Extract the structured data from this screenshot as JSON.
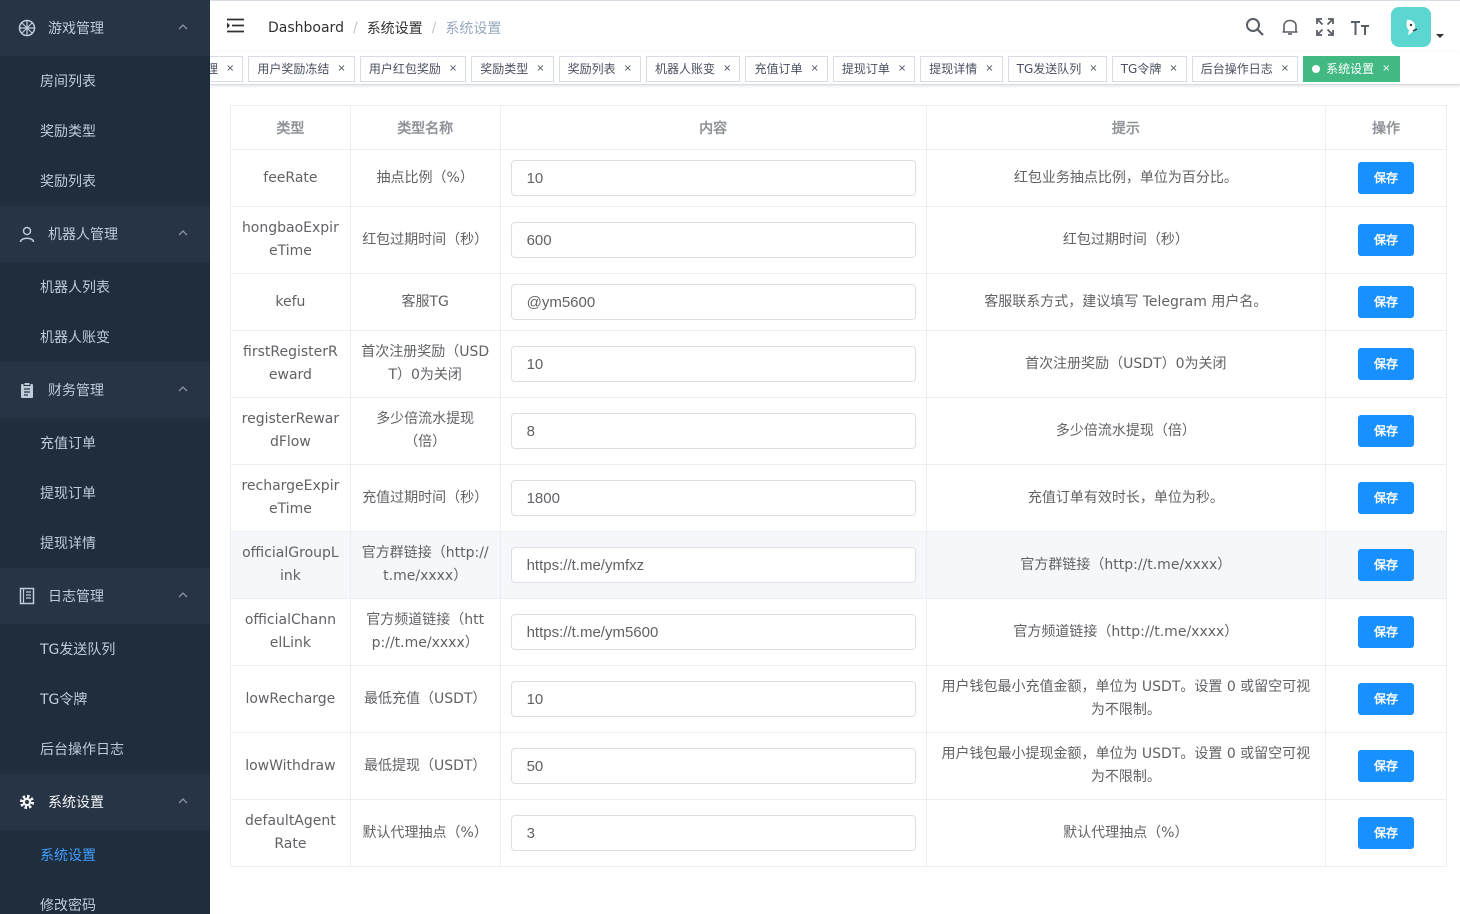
{
  "sidebar": {
    "groups": [
      {
        "label": "游戏管理",
        "icon": "game-icon",
        "items": [
          "房间列表",
          "奖励类型",
          "奖励列表"
        ]
      },
      {
        "label": "机器人管理",
        "icon": "user-icon",
        "items": [
          "机器人列表",
          "机器人账变"
        ]
      },
      {
        "label": "财务管理",
        "icon": "clipboard-icon",
        "items": [
          "充值订单",
          "提现订单",
          "提现详情"
        ]
      },
      {
        "label": "日志管理",
        "icon": "document-icon",
        "items": [
          "TG发送队列",
          "TG令牌",
          "后台操作日志"
        ]
      },
      {
        "label": "系统设置",
        "icon": "gear-icon",
        "items": [
          "系统设置",
          "修改密码"
        ]
      }
    ]
  },
  "breadcrumb": {
    "home": "Dashboard",
    "parent": "系统设置",
    "current": "系统设置"
  },
  "tags": [
    "管理",
    "用户奖励冻结",
    "用户红包奖励",
    "奖励类型",
    "奖励列表",
    "机器人账变",
    "充值订单",
    "提现订单",
    "提现详情",
    "TG发送队列",
    "TG令牌",
    "后台操作日志",
    "系统设置"
  ],
  "table": {
    "headers": {
      "type": "类型",
      "name": "类型名称",
      "content": "内容",
      "hint": "提示",
      "action": "操作"
    },
    "save_label": "保存",
    "rows": [
      {
        "type": "feeRate",
        "name": "抽点比例（%）",
        "value": "10",
        "hint": "红包业务抽点比例，单位为百分比。"
      },
      {
        "type": "hongbaoExpireTime",
        "name": "红包过期时间（秒）",
        "value": "600",
        "hint": "红包过期时间（秒）"
      },
      {
        "type": "kefu",
        "name": "客服TG",
        "value": "@ym5600",
        "hint": "客服联系方式，建议填写 Telegram 用户名。"
      },
      {
        "type": "firstRegisterReward",
        "name": "首次注册奖励（USDT）0为关闭",
        "value": "10",
        "hint": "首次注册奖励（USDT）0为关闭"
      },
      {
        "type": "registerRewardFlow",
        "name": "多少倍流水提现（倍）",
        "value": "8",
        "hint": "多少倍流水提现（倍）"
      },
      {
        "type": "rechargeExpireTime",
        "name": "充值过期时间（秒）",
        "value": "1800",
        "hint": "充值订单有效时长，单位为秒。"
      },
      {
        "type": "officialGroupLink",
        "name": "官方群链接（http://t.me/xxxx）",
        "value": "https://t.me/ymfxz",
        "hint": "官方群链接（http://t.me/xxxx）"
      },
      {
        "type": "officialChannelLink",
        "name": "官方频道链接（http://t.me/xxxx）",
        "value": "https://t.me/ym5600",
        "hint": "官方频道链接（http://t.me/xxxx）"
      },
      {
        "type": "lowRecharge",
        "name": "最低充值（USDT）",
        "value": "10",
        "hint": "用户钱包最小充值金额，单位为 USDT。设置 0 或留空可视为不限制。"
      },
      {
        "type": "lowWithdraw",
        "name": "最低提现（USDT）",
        "value": "50",
        "hint": "用户钱包最小提现金额，单位为 USDT。设置 0 或留空可视为不限制。"
      },
      {
        "type": "defaultAgentRate",
        "name": "默认代理抽点（%）",
        "value": "3",
        "hint": "默认代理抽点（%）"
      }
    ]
  },
  "colors": {
    "sidebar": "#304156",
    "submenu": "#1f2d3d",
    "active_tag": "#42b983",
    "primary": "#1890ff"
  }
}
